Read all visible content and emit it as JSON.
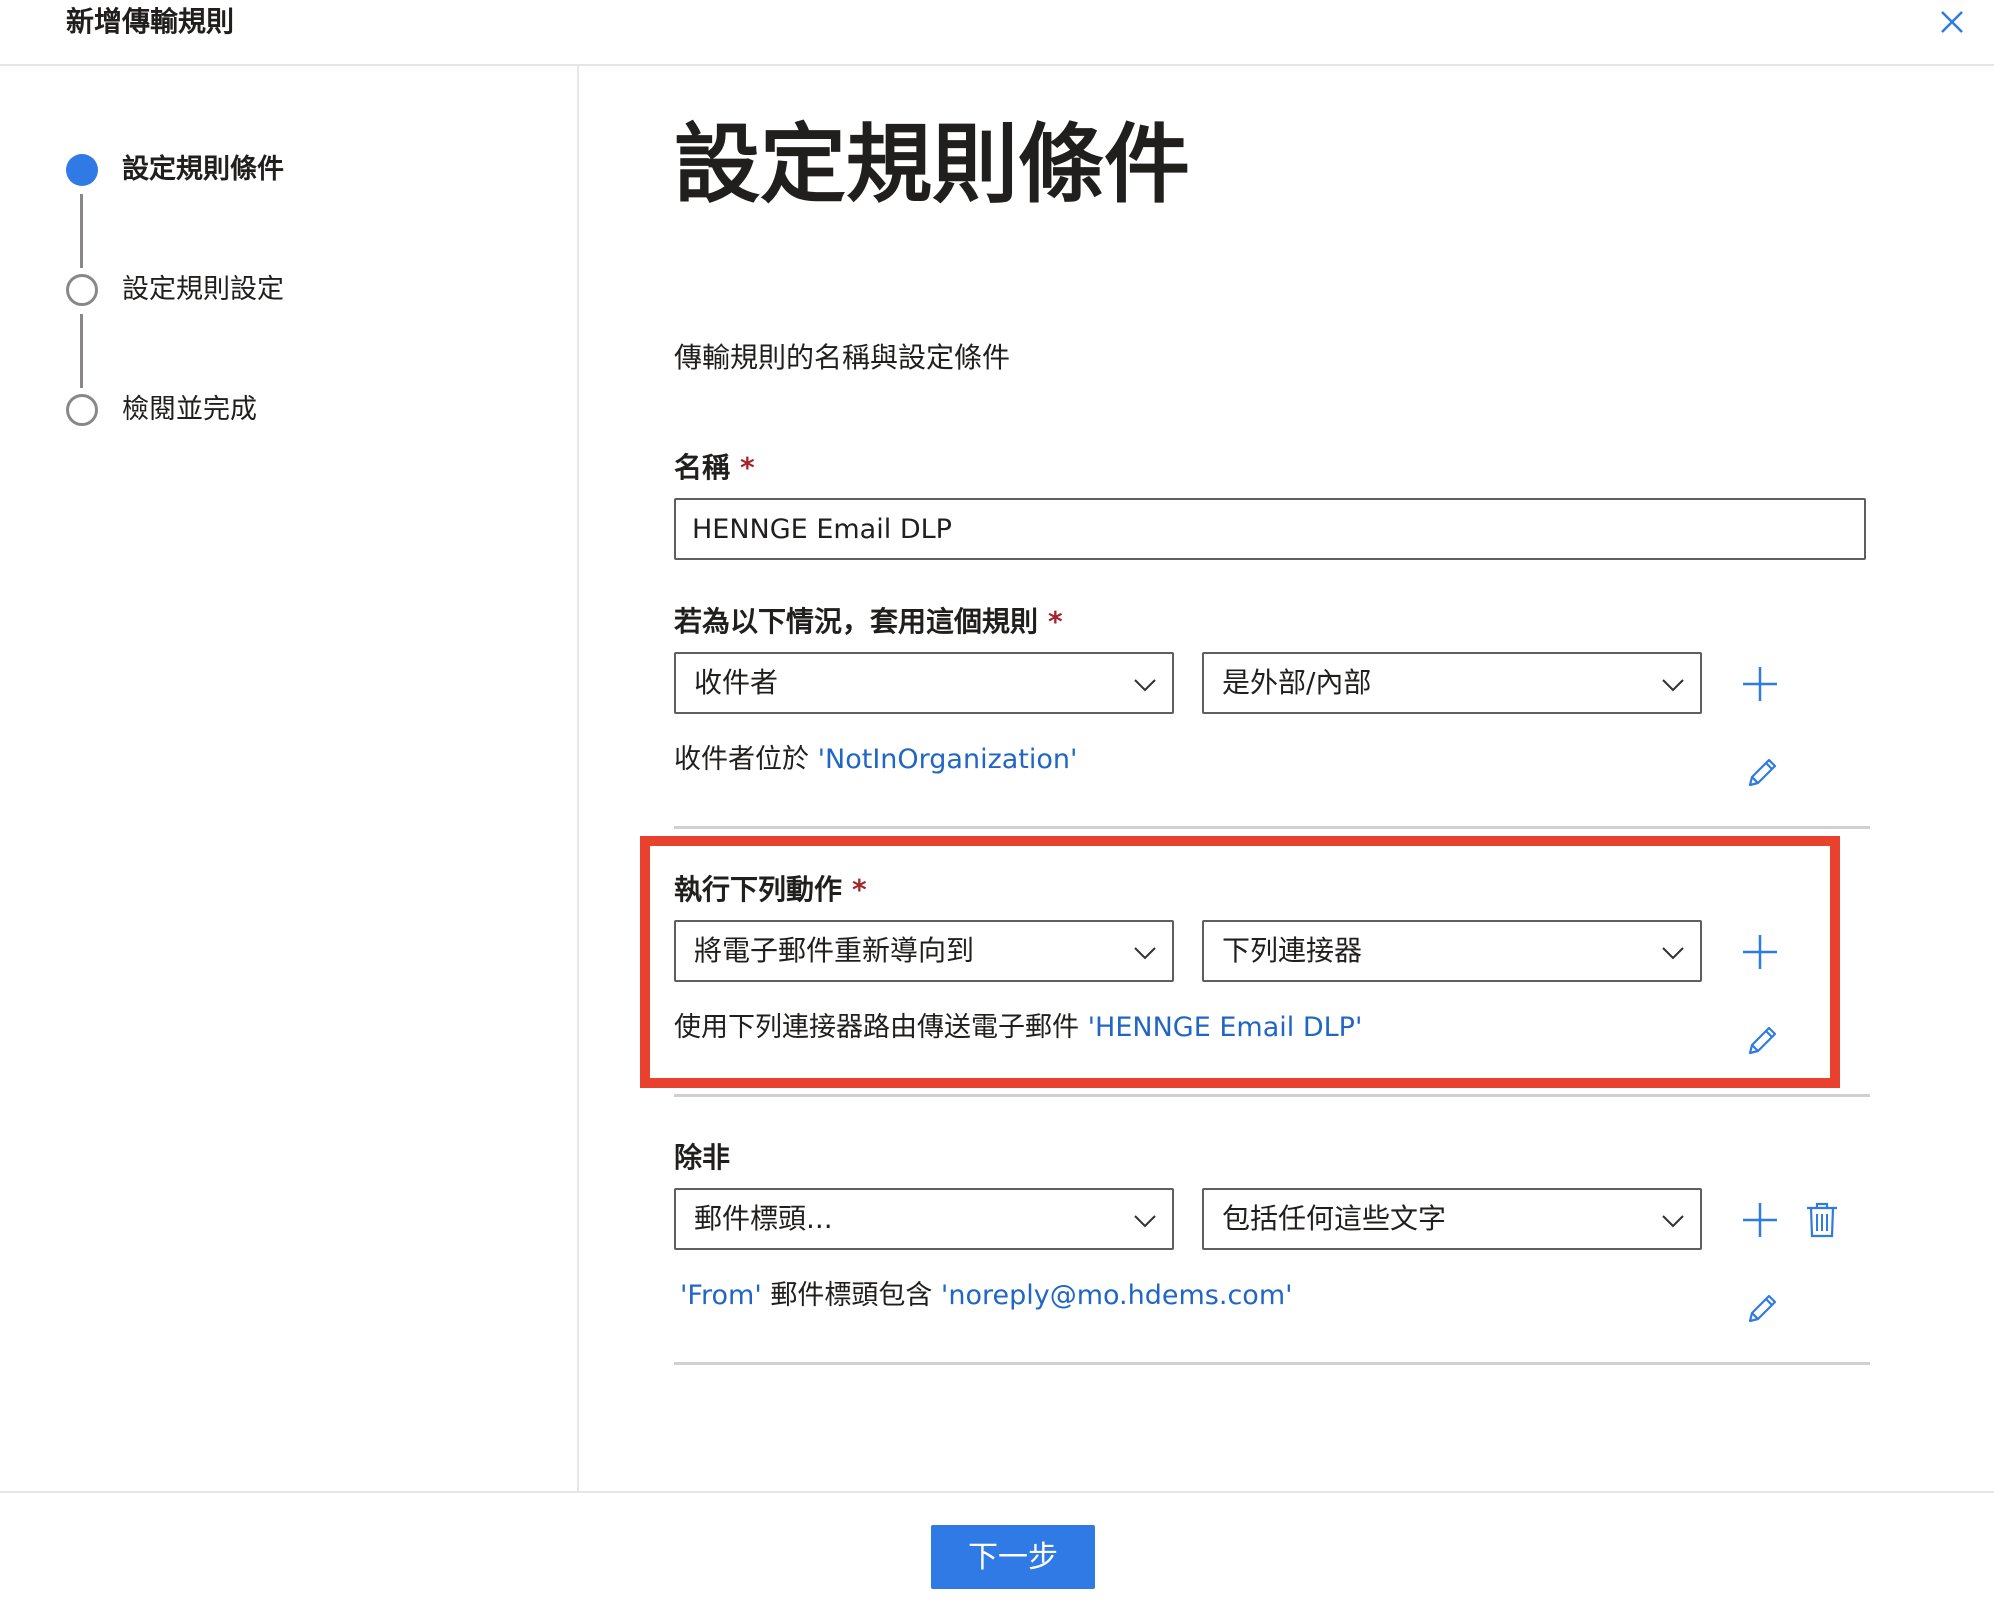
{
  "dialog": {
    "title": "新增傳輸規則"
  },
  "steps": [
    {
      "label": "設定規則條件",
      "state": "active"
    },
    {
      "label": "設定規則設定",
      "state": "inactive"
    },
    {
      "label": "檢閱並完成",
      "state": "inactive"
    }
  ],
  "page": {
    "title": "設定規則條件",
    "subtitle": "傳輸規則的名稱與設定條件"
  },
  "name_field": {
    "label": "名稱",
    "required_mark": "*",
    "value": "HENNGE Email DLP"
  },
  "apply_section": {
    "label": "若為以下情況，套用這個規則",
    "required_mark": "*",
    "dropdown1": "收件者",
    "dropdown2": "是外部/內部",
    "summary_text": "收件者位於 ",
    "summary_link": "'NotInOrganization'"
  },
  "action_section": {
    "label": "執行下列動作",
    "required_mark": "*",
    "dropdown1": "將電子郵件重新導向到",
    "dropdown2": "下列連接器",
    "summary_text": "使用下列連接器路由傳送電子郵件 ",
    "summary_link": "'HENNGE Email DLP'"
  },
  "except_section": {
    "label": "除非",
    "dropdown1": "郵件標頭...",
    "dropdown2": "包括任何這些文字",
    "summary_link1": "'From'",
    "summary_text": " 郵件標頭包含 ",
    "summary_link2": "'noreply@mo.hdems.com'"
  },
  "footer": {
    "next_label": "下一步"
  },
  "colors": {
    "accent": "#2f7ae5",
    "link": "#2266c5",
    "required": "#a4262c",
    "highlight": "#e8412e"
  },
  "icons": {
    "close": "close-icon",
    "dropdown": "chevron-down-icon",
    "add": "plus-icon",
    "edit": "pencil-icon",
    "delete": "trash-icon"
  }
}
